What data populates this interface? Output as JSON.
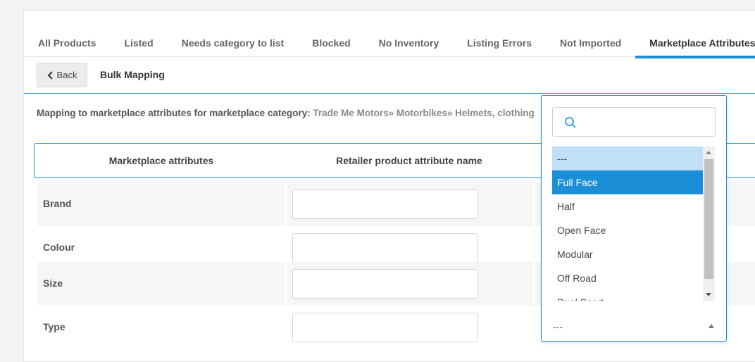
{
  "tabs": [
    {
      "label": "All Products"
    },
    {
      "label": "Listed"
    },
    {
      "label": "Needs category to list"
    },
    {
      "label": "Blocked"
    },
    {
      "label": "No Inventory"
    },
    {
      "label": "Listing Errors"
    },
    {
      "label": "Not Imported"
    },
    {
      "label": "Marketplace Attributes"
    }
  ],
  "active_tab": "Marketplace Attributes",
  "toolbar": {
    "back_label": "Back",
    "title": "Bulk Mapping"
  },
  "mapping": {
    "prefix": "Mapping to marketplace attributes for marketplace category:",
    "path": "Trade Me Motors» Motorbikes» Helmets, clothing"
  },
  "table": {
    "headers": [
      "Marketplace attributes",
      "Retailer product attribute name"
    ],
    "rows": [
      {
        "label": "Brand",
        "value": ""
      },
      {
        "label": "Colour",
        "value": ""
      },
      {
        "label": "Size",
        "value": ""
      },
      {
        "label": "Type",
        "value": ""
      }
    ]
  },
  "dropdown": {
    "search_value": "",
    "options": [
      "---",
      "Full Face",
      "Half",
      "Open Face",
      "Modular",
      "Off Road",
      "Dual Sport"
    ],
    "selected": "---",
    "highlighted": "Full Face",
    "current_value": "---"
  },
  "colors": {
    "accent": "#1a8fd8",
    "selected_option_bg": "#bfe0f7",
    "row_alt_bg": "#f6f6f6"
  }
}
